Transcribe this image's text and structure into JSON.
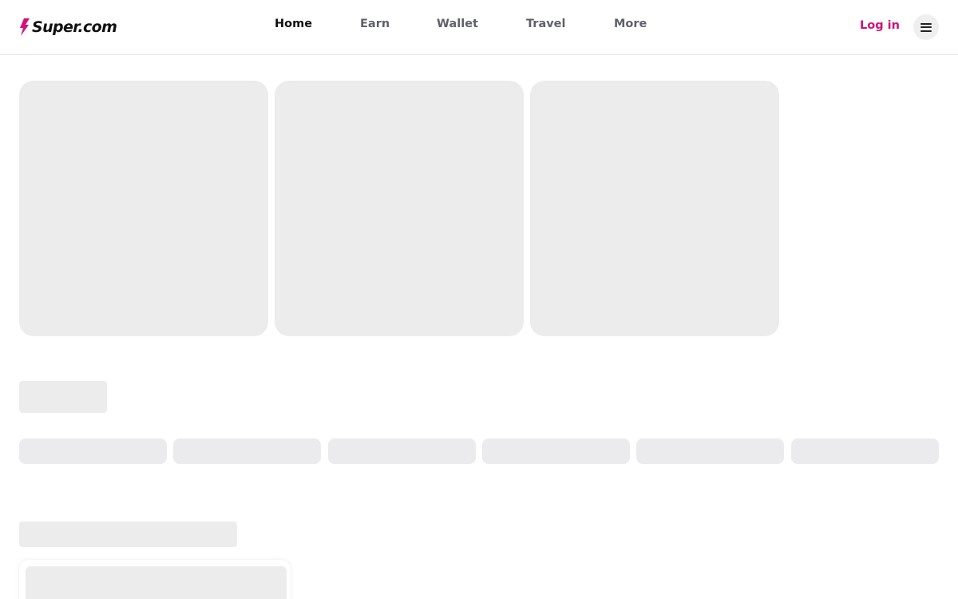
{
  "header": {
    "logo_text": "Super.com",
    "nav": [
      {
        "label": "Home",
        "active": true
      },
      {
        "label": "Earn",
        "active": false
      },
      {
        "label": "Wallet",
        "active": false
      },
      {
        "label": "Travel",
        "active": false
      },
      {
        "label": "More",
        "active": false
      }
    ],
    "login_label": "Log in",
    "menu_icon": "hamburger-menu-icon"
  },
  "colors": {
    "brand_accent": "#d0127a",
    "skeleton": "#ececed",
    "active_nav": "#111111",
    "inactive_nav": "#5f6168"
  },
  "state": "loading-skeleton"
}
